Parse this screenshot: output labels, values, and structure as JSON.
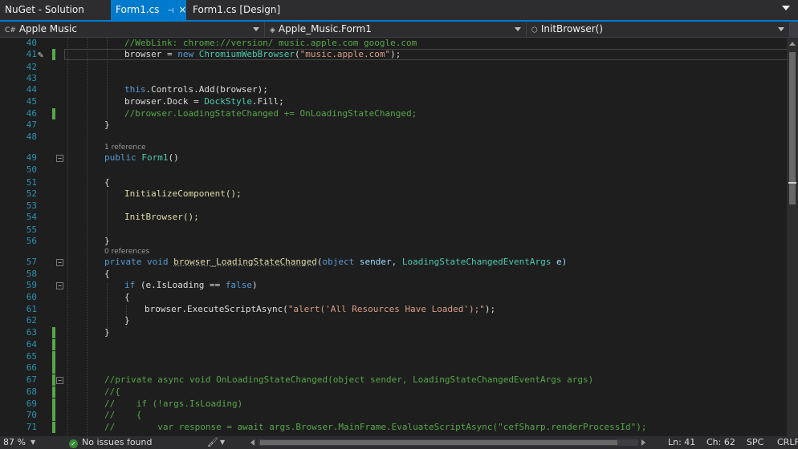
{
  "tabs": {
    "solution": "NuGet - Solution",
    "active": "Form1.cs",
    "design": "Form1.cs [Design]",
    "pin_glyph": "⊣",
    "close_glyph": "×"
  },
  "navbar": {
    "project": "Apple Music",
    "class": "Apple_Music.Form1",
    "member": "InitBrowser()"
  },
  "editor": {
    "line_numbers": [
      "40",
      "41",
      "42",
      "43",
      "44",
      "45",
      "46",
      "47",
      "48",
      "49",
      "50",
      "51",
      "52",
      "53",
      "54",
      "55",
      "56",
      "57",
      "58",
      "59",
      "60",
      "61",
      "62",
      "63",
      "64",
      "65",
      "66",
      "67",
      "68",
      "69",
      "70",
      "71"
    ],
    "lines": {
      "l40": "//WebLink: chrome://version/ music.apple.com google.com",
      "l41_a": "browser = ",
      "l41_new": "new",
      "l41_type": "ChromiumWebBrowser",
      "l41_p1": "(",
      "l41_str": "\"music.apple.com\"",
      "l41_p2": ");",
      "l44_this": "this",
      "l44_rest": ".Controls.Add(browser);",
      "l45_a": "browser.Dock = ",
      "l45_type": "DockStyle",
      "l45_rest": ".Fill;",
      "l46": "//browser.LoadingStateChanged += OnLoadingStateChanged;",
      "l47": "}",
      "ref48": "1 reference",
      "l49_kw": "public",
      "l49_type": "Form1",
      "l49_rest": "()",
      "l51": "{",
      "l52": "InitializeComponent();",
      "l54": "InitBrowser();",
      "l56": "}",
      "ref57": "0 references",
      "l57_k1": "private",
      "l57_k2": "void",
      "l57_name": "browser_LoadingStateChanged",
      "l57_p1": "(",
      "l57_k3": "object",
      "l57_p2": " sender, ",
      "l57_type": "LoadingStateChangedEventArgs",
      "l57_p3": " e)",
      "l58": "{",
      "l59_kw": "if",
      "l59_mid": " (e.IsLoading == ",
      "l59_false": "false",
      "l59_end": ")",
      "l60": "{",
      "l61_a": "browser.ExecuteScriptAsync(",
      "l61_str": "\"alert('All Resources Have Loaded');\"",
      "l61_end": ");",
      "l62": "}",
      "l63": "}",
      "l67": "//private async void OnLoadingStateChanged(object sender, LoadingStateChangedEventArgs args)",
      "l68": "//{",
      "l69": "//    if (!args.IsLoading)",
      "l70": "//    {",
      "l71": "//        var response = await args.Browser.MainFrame.EvaluateScriptAsync(\"cefSharp.renderProcessId\");"
    }
  },
  "statusbar": {
    "zoom": "87 %",
    "issues": "No issues found",
    "ln": "Ln: 41",
    "ch": "Ch: 62",
    "spc": "SPC",
    "crlf": "CRLF"
  },
  "colors": {
    "accent": "#007acc",
    "keyword": "#569cd6",
    "type": "#4ec9b0",
    "string": "#d69d85",
    "comment": "#57a64a",
    "line_number": "#2b91af"
  }
}
